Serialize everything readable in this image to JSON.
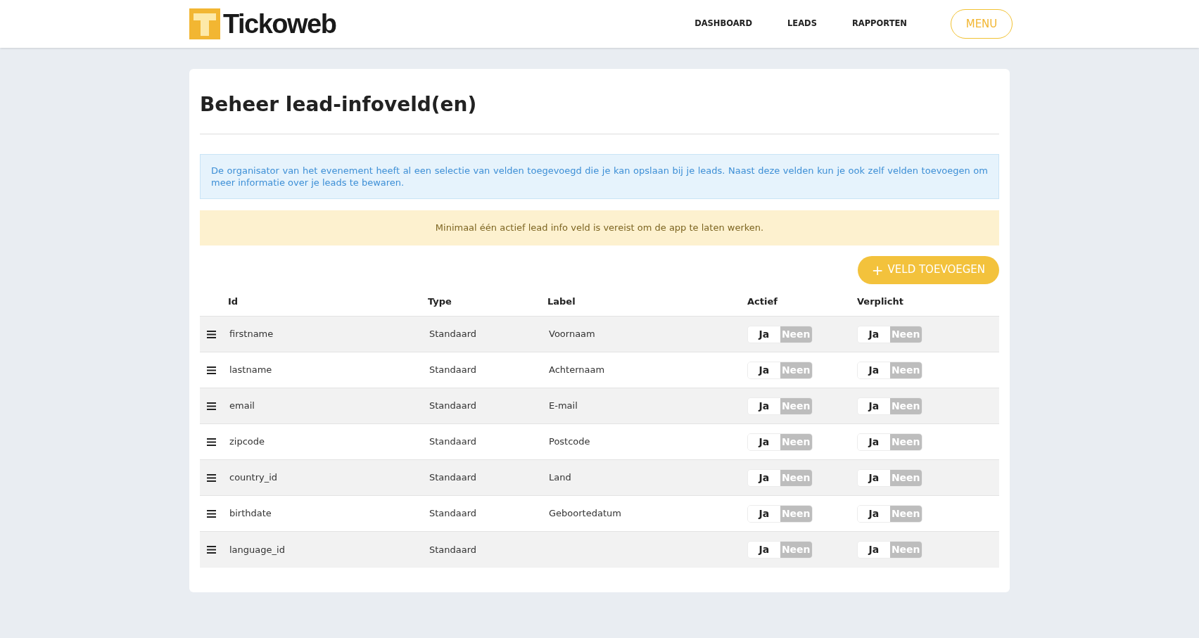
{
  "header": {
    "logo_text": "Tickoweb",
    "nav": [
      {
        "label": "DASHBOARD"
      },
      {
        "label": "LEADS"
      },
      {
        "label": "RAPPORTEN"
      }
    ],
    "menu_button": "MENU"
  },
  "page": {
    "title": "Beheer lead-infoveld(en)",
    "info_alert": "De organisator van het evenement heeft al een selectie van velden toegevoegd die je kan opslaan bij je leads. Naast deze velden kun je ook zelf velden toevoegen om meer informatie over je leads te bewaren.",
    "warning_alert": "Minimaal één actief lead info veld is vereist om de app te laten werken.",
    "add_button": {
      "icon": "+",
      "label": "VELD TOEVOEGEN"
    },
    "table": {
      "columns": [
        "Id",
        "Type",
        "Label",
        "Actief",
        "Verplicht"
      ],
      "rows": [
        {
          "id": "firstname",
          "type": "Standaard",
          "label": "Voornaam",
          "active": {
            "yes": "Ja",
            "no": "Neen",
            "on": true
          },
          "required": {
            "yes": "Ja",
            "no": "Neen",
            "on": true
          }
        },
        {
          "id": "lastname",
          "type": "Standaard",
          "label": "Achternaam",
          "active": {
            "yes": "Ja",
            "no": "Neen",
            "on": true
          },
          "required": {
            "yes": "Ja",
            "no": "Neen",
            "on": true
          }
        },
        {
          "id": "email",
          "type": "Standaard",
          "label": "E-mail",
          "active": {
            "yes": "Ja",
            "no": "Neen",
            "on": true
          },
          "required": {
            "yes": "Ja",
            "no": "Neen",
            "on": true
          }
        },
        {
          "id": "zipcode",
          "type": "Standaard",
          "label": "Postcode",
          "active": {
            "yes": "Ja",
            "no": "Neen",
            "on": true
          },
          "required": {
            "yes": "Ja",
            "no": "Neen",
            "on": true
          }
        },
        {
          "id": "country_id",
          "type": "Standaard",
          "label": "Land",
          "active": {
            "yes": "Ja",
            "no": "Neen",
            "on": true
          },
          "required": {
            "yes": "Ja",
            "no": "Neen",
            "on": true
          }
        },
        {
          "id": "birthdate",
          "type": "Standaard",
          "label": "Geboortedatum",
          "active": {
            "yes": "Ja",
            "no": "Neen",
            "on": true
          },
          "required": {
            "yes": "Ja",
            "no": "Neen",
            "on": true
          }
        },
        {
          "id": "language_id",
          "type": "Standaard",
          "label": "",
          "active": {
            "yes": "Ja",
            "no": "Neen",
            "on": true
          },
          "required": {
            "yes": "Ja",
            "no": "Neen",
            "on": true
          }
        }
      ]
    }
  }
}
